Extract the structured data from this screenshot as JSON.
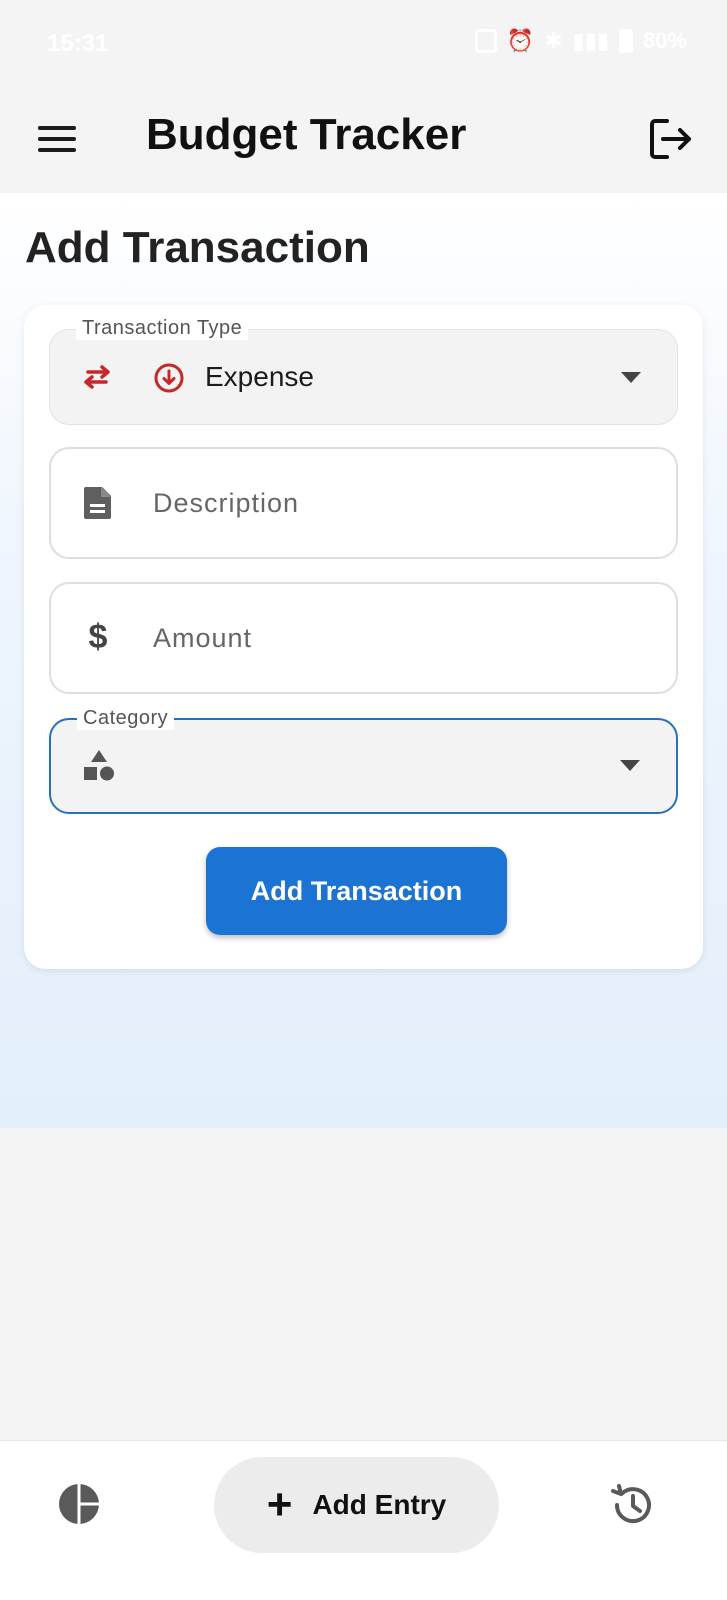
{
  "status_bar": {
    "time": "15:31",
    "battery": "80%"
  },
  "app_bar": {
    "title": "Budget Tracker",
    "menu_icon": "hamburger-menu-icon",
    "logout_icon": "logout-icon"
  },
  "page": {
    "title": "Add Transaction"
  },
  "form": {
    "transaction_type": {
      "label": "Transaction Type",
      "value": "Expense",
      "icon": "swap-arrows-icon",
      "value_icon": "arrow-down-circle-icon"
    },
    "description": {
      "placeholder": "Description",
      "value": "",
      "icon": "document-icon"
    },
    "amount": {
      "placeholder": "Amount",
      "value": "",
      "icon": "dollar-icon"
    },
    "category": {
      "label": "Category",
      "value": "",
      "icon": "shapes-icon"
    },
    "submit_label": "Add Transaction"
  },
  "bottom_nav": {
    "stats_icon": "pie-chart-icon",
    "add_label": "Add Entry",
    "add_icon": "plus-icon",
    "history_icon": "history-icon"
  },
  "colors": {
    "accent": "#1b74d3",
    "expense_red": "#c62828",
    "focused_border": "#2a6fbd"
  }
}
